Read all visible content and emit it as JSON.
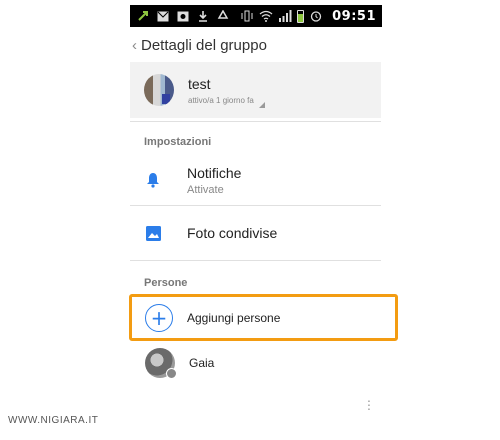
{
  "status_bar": {
    "time": "09:51",
    "icons": [
      "usb-icon",
      "gmail-icon",
      "photo-icon",
      "download-icon",
      "recycle-icon",
      "vibrate-icon",
      "wifi-icon",
      "signal-icon",
      "battery-icon",
      "alarm-icon"
    ]
  },
  "header": {
    "back_glyph": "‹",
    "title": "Dettagli del gruppo"
  },
  "group": {
    "name": "test",
    "status": "attivo/a 1 giorno fa"
  },
  "settings": {
    "section_label": "Impostazioni",
    "notifications": {
      "title": "Notifiche",
      "subtitle": "Attivate"
    },
    "shared_photos": {
      "title": "Foto condivise"
    }
  },
  "people": {
    "section_label": "Persone",
    "add_label": "Aggiungi persone",
    "members": [
      {
        "name": "Gaia"
      }
    ]
  },
  "colors": {
    "accent": "#2b7de9",
    "highlight": "#f39c12"
  },
  "watermark": "WWW.NIGIARA.IT"
}
